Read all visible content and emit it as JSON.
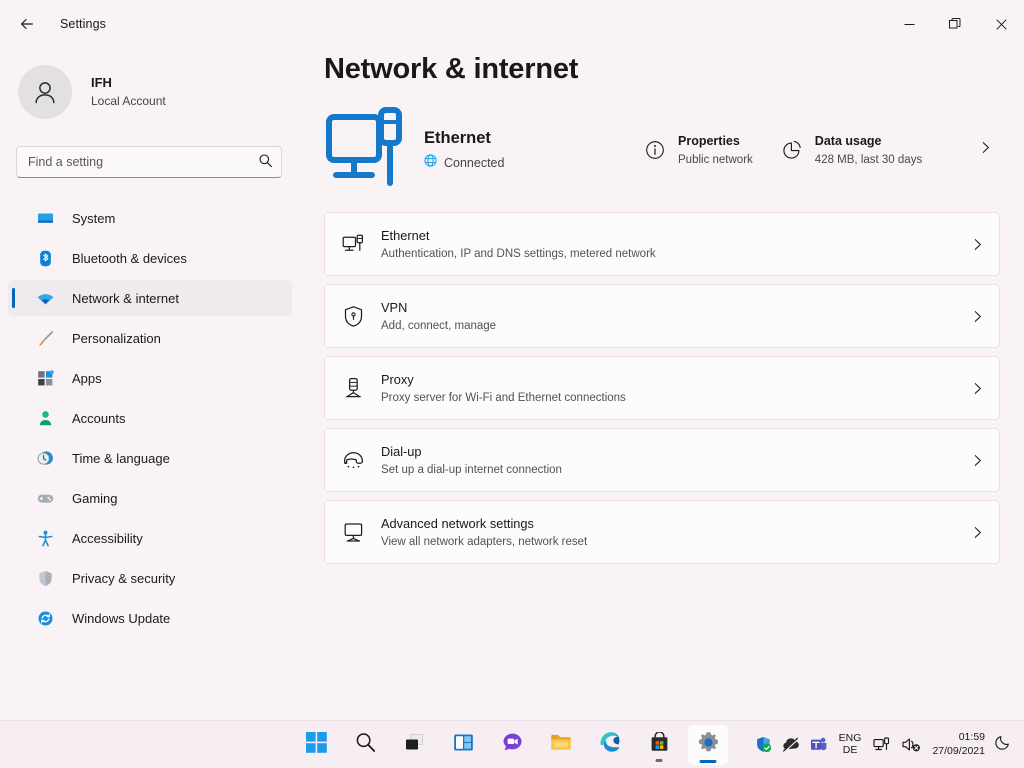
{
  "window": {
    "title": "Settings",
    "back_icon": "back-arrow-icon",
    "minimize_label": "Minimize",
    "maximize_label": "Restore",
    "close_label": "Close"
  },
  "accent_color": "#0067c0",
  "background_color": "#f9f3f6",
  "card_color": "#fdfcfd",
  "sidebar": {
    "profile": {
      "name": "IFH",
      "account_type": "Local Account",
      "avatar_icon": "person-avatar-icon"
    },
    "search": {
      "placeholder": "Find a setting",
      "value": "",
      "icon": "search-icon"
    },
    "items": [
      {
        "label": "System",
        "icon": "system-monitor-icon",
        "selected": false
      },
      {
        "label": "Bluetooth & devices",
        "icon": "bluetooth-icon",
        "selected": false
      },
      {
        "label": "Network & internet",
        "icon": "wifi-icon",
        "selected": true
      },
      {
        "label": "Personalization",
        "icon": "paintbrush-icon",
        "selected": false
      },
      {
        "label": "Apps",
        "icon": "apps-grid-icon",
        "selected": false
      },
      {
        "label": "Accounts",
        "icon": "account-person-icon",
        "selected": false
      },
      {
        "label": "Time & language",
        "icon": "clock-globe-icon",
        "selected": false
      },
      {
        "label": "Gaming",
        "icon": "gamepad-icon",
        "selected": false
      },
      {
        "label": "Accessibility",
        "icon": "accessibility-person-icon",
        "selected": false
      },
      {
        "label": "Privacy & security",
        "icon": "shield-icon",
        "selected": false
      },
      {
        "label": "Windows Update",
        "icon": "update-refresh-icon",
        "selected": false
      }
    ]
  },
  "main": {
    "page_title": "Network & internet",
    "hero": {
      "icon": "ethernet-monitor-icon",
      "name": "Ethernet",
      "status": "Connected",
      "status_icon": "globe-icon",
      "links": [
        {
          "title": "Properties",
          "subtitle": "Public network",
          "icon": "info-circle-icon"
        },
        {
          "title": "Data usage",
          "subtitle": "428 MB, last 30 days",
          "icon": "pie-chart-icon"
        }
      ],
      "chevron_icon": "chevron-right-icon"
    },
    "cards": [
      {
        "title": "Ethernet",
        "subtitle": "Authentication, IP and DNS settings, metered network",
        "icon": "ethernet-port-icon",
        "chevron_icon": "chevron-right-icon"
      },
      {
        "title": "VPN",
        "subtitle": "Add, connect, manage",
        "icon": "vpn-shield-icon",
        "chevron_icon": "chevron-right-icon"
      },
      {
        "title": "Proxy",
        "subtitle": "Proxy server for Wi-Fi and Ethernet connections",
        "icon": "proxy-server-icon",
        "chevron_icon": "chevron-right-icon"
      },
      {
        "title": "Dial-up",
        "subtitle": "Set up a dial-up internet connection",
        "icon": "phone-handset-icon",
        "chevron_icon": "chevron-right-icon"
      },
      {
        "title": "Advanced network settings",
        "subtitle": "View all network adapters, network reset",
        "icon": "network-adapter-icon",
        "chevron_icon": "chevron-right-icon"
      }
    ]
  },
  "taskbar": {
    "items": [
      {
        "name": "start-button",
        "icon": "windows-start-icon",
        "state": "idle"
      },
      {
        "name": "search-taskbar-button",
        "icon": "search-icon",
        "state": "idle"
      },
      {
        "name": "task-view-button",
        "icon": "task-view-icon",
        "state": "idle"
      },
      {
        "name": "widgets-button",
        "icon": "widgets-icon",
        "state": "idle"
      },
      {
        "name": "chat-button",
        "icon": "chat-bubble-icon",
        "state": "idle"
      },
      {
        "name": "file-explorer-button",
        "icon": "folder-icon",
        "state": "idle"
      },
      {
        "name": "edge-button",
        "icon": "edge-browser-icon",
        "state": "idle"
      },
      {
        "name": "microsoft-store-button",
        "icon": "store-bag-icon",
        "state": "running"
      },
      {
        "name": "settings-button",
        "icon": "gear-icon",
        "state": "active"
      }
    ],
    "tray": {
      "icons": [
        {
          "name": "windows-security-tray-icon",
          "icon": "shield-check-icon"
        },
        {
          "name": "hidden-tray-icon",
          "icon": "crossed-cloud-icon"
        },
        {
          "name": "teams-tray-icon",
          "icon": "teams-icon"
        }
      ],
      "language": {
        "line1": "ENG",
        "line2": "DE"
      },
      "network_icon": "ethernet-tray-icon",
      "volume_icon": "speaker-muted-icon",
      "clock": {
        "time": "01:59",
        "date": "27/09/2021"
      },
      "notification_icon": "moon-icon"
    }
  }
}
